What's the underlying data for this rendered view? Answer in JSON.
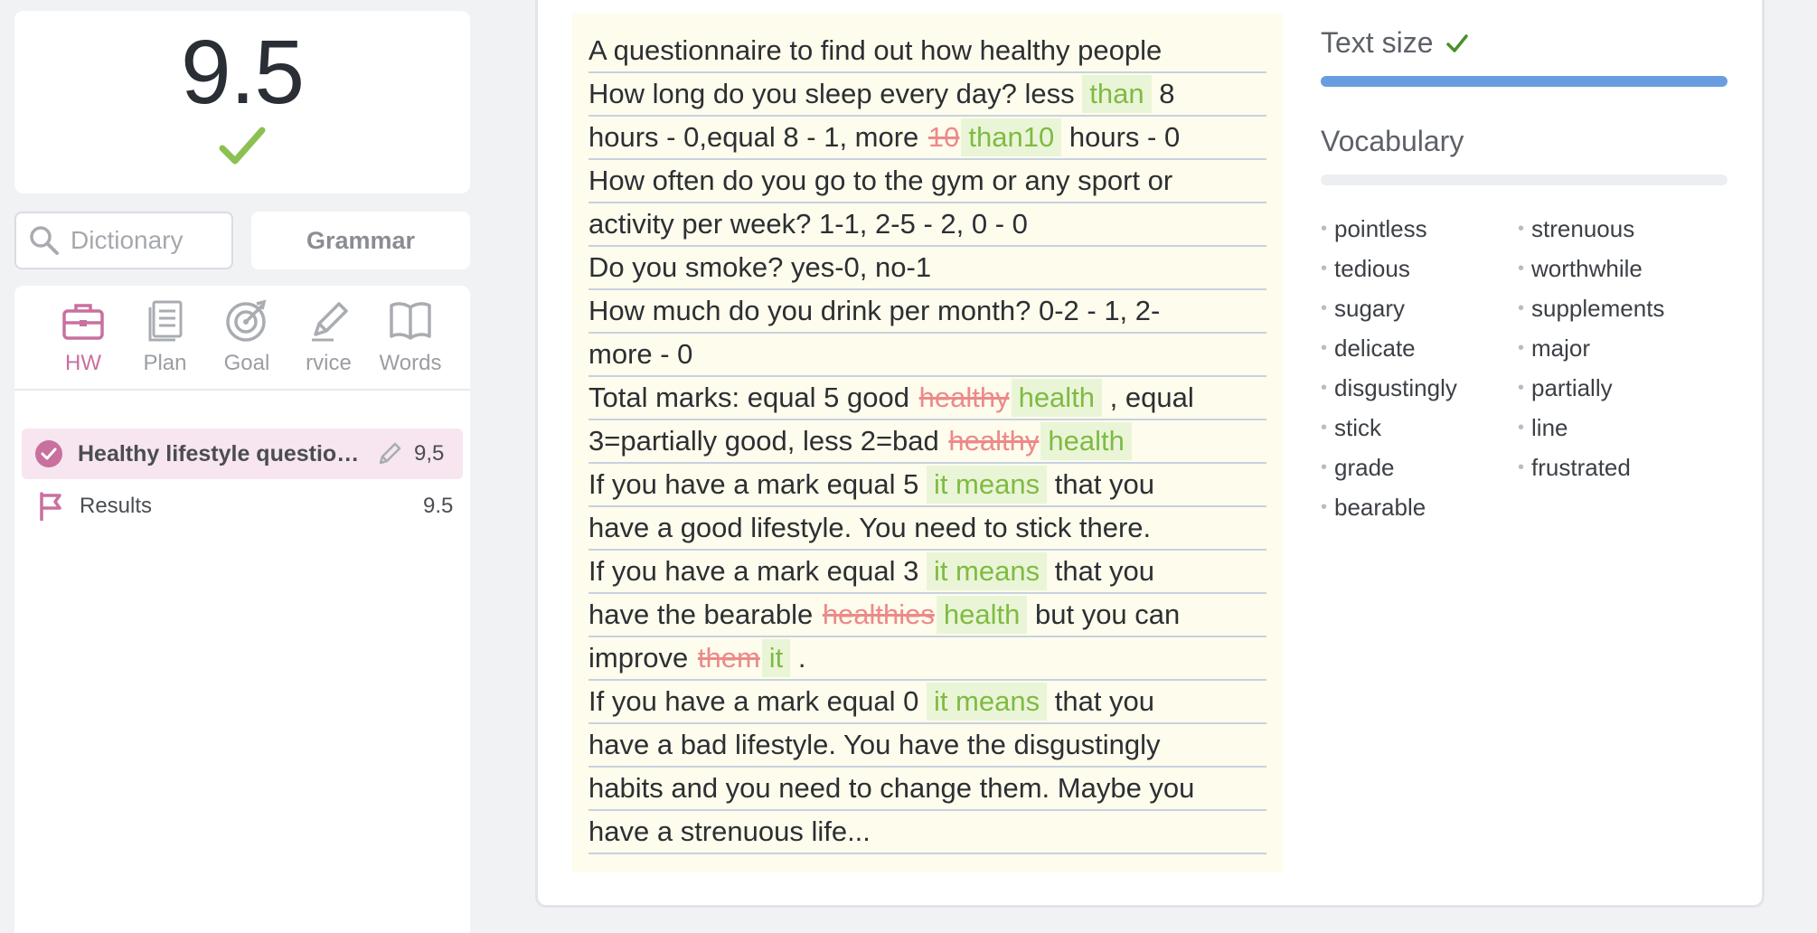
{
  "score_card": {
    "score": "9.5"
  },
  "search": {
    "placeholder": "Dictionary"
  },
  "grammar_label": "Grammar",
  "nav": {
    "tabs": [
      {
        "label": "HW",
        "icon": "briefcase-icon",
        "active": true
      },
      {
        "label": "Plan",
        "icon": "document-stack-icon",
        "active": false
      },
      {
        "label": "Goal",
        "icon": "target-icon",
        "active": false
      },
      {
        "label": "rvice",
        "icon": "pen-icon",
        "active": false
      },
      {
        "label": "Words",
        "icon": "book-icon",
        "active": false
      }
    ]
  },
  "lesson": {
    "title": "Healthy lifestyle question...",
    "score": "9,5"
  },
  "results": {
    "label": "Results",
    "score": "9.5"
  },
  "essay": {
    "lines": [
      [
        {
          "t": "t",
          "v": " A questionnaire to find out how healthy people"
        }
      ],
      [
        {
          "t": "t",
          "v": "How long do you sleep every day? less "
        },
        {
          "t": "i",
          "v": "than"
        },
        {
          "t": "t",
          "v": " 8"
        }
      ],
      [
        {
          "t": "t",
          "v": "hours - 0,equal 8 - 1, more "
        },
        {
          "t": "d",
          "v": "10"
        },
        {
          "t": "i",
          "v": "than10"
        },
        {
          "t": "t",
          "v": " hours - 0"
        }
      ],
      [
        {
          "t": "t",
          "v": "How often do you go to the gym or any sport or"
        }
      ],
      [
        {
          "t": "t",
          "v": "activity per week? 1-1, 2-5 - 2, 0 - 0"
        }
      ],
      [
        {
          "t": "t",
          "v": "Do you smoke? yes-0, no-1"
        }
      ],
      [
        {
          "t": "t",
          "v": "How much do you drink per month? 0-2 - 1, 2-"
        }
      ],
      [
        {
          "t": "t",
          "v": "more - 0"
        }
      ],
      [
        {
          "t": "t",
          "v": "Total marks: equal 5 good "
        },
        {
          "t": "d",
          "v": "healthy"
        },
        {
          "t": "i",
          "v": "health"
        },
        {
          "t": "t",
          "v": " , equal"
        }
      ],
      [
        {
          "t": "t",
          "v": "3=partially good, less 2=bad "
        },
        {
          "t": "d",
          "v": "healthy"
        },
        {
          "t": "i",
          "v": "health"
        }
      ],
      [
        {
          "t": "t",
          "v": "If you have a mark equal 5 "
        },
        {
          "t": "i",
          "v": "it means"
        },
        {
          "t": "t",
          "v": " that you"
        }
      ],
      [
        {
          "t": "t",
          "v": "have a good lifestyle. You need to stick there."
        }
      ],
      [
        {
          "t": "t",
          "v": "If you have a mark equal 3 "
        },
        {
          "t": "i",
          "v": "it means"
        },
        {
          "t": "t",
          "v": " that you"
        }
      ],
      [
        {
          "t": "t",
          "v": "have the bearable "
        },
        {
          "t": "d",
          "v": "healthies"
        },
        {
          "t": "i",
          "v": "health"
        },
        {
          "t": "t",
          "v": " but you can"
        }
      ],
      [
        {
          "t": "t",
          "v": "improve "
        },
        {
          "t": "d",
          "v": "them"
        },
        {
          "t": "i",
          "v": "it"
        },
        {
          "t": "t",
          "v": " ."
        }
      ],
      [
        {
          "t": "t",
          "v": "If you have a mark equal 0 "
        },
        {
          "t": "i",
          "v": "it means"
        },
        {
          "t": "t",
          "v": " that you"
        }
      ],
      [
        {
          "t": "t",
          "v": "have a bad lifestyle. You have the disgustingly"
        }
      ],
      [
        {
          "t": "t",
          "v": "habits and you need to change them. Maybe you"
        }
      ],
      [
        {
          "t": "t",
          "v": "have a strenuous life..."
        }
      ]
    ]
  },
  "text_size": {
    "label": "Text size",
    "progress": 1.0
  },
  "vocabulary": {
    "label": "Vocabulary",
    "progress": 0.0,
    "columns": [
      [
        "pointless",
        "tedious",
        "sugary",
        "delicate",
        "disgustingly",
        "stick",
        "grade",
        "bearable"
      ],
      [
        "strenuous",
        "worthwhile",
        "supplements",
        "major",
        "partially",
        "line",
        "frustrated"
      ]
    ]
  },
  "colors": {
    "accent_pink": "#c9709f",
    "check_green": "#8cc152",
    "insert_green": "#7fbb42",
    "delete_red": "#ec8a8a",
    "progress_blue": "#6a9de0"
  }
}
